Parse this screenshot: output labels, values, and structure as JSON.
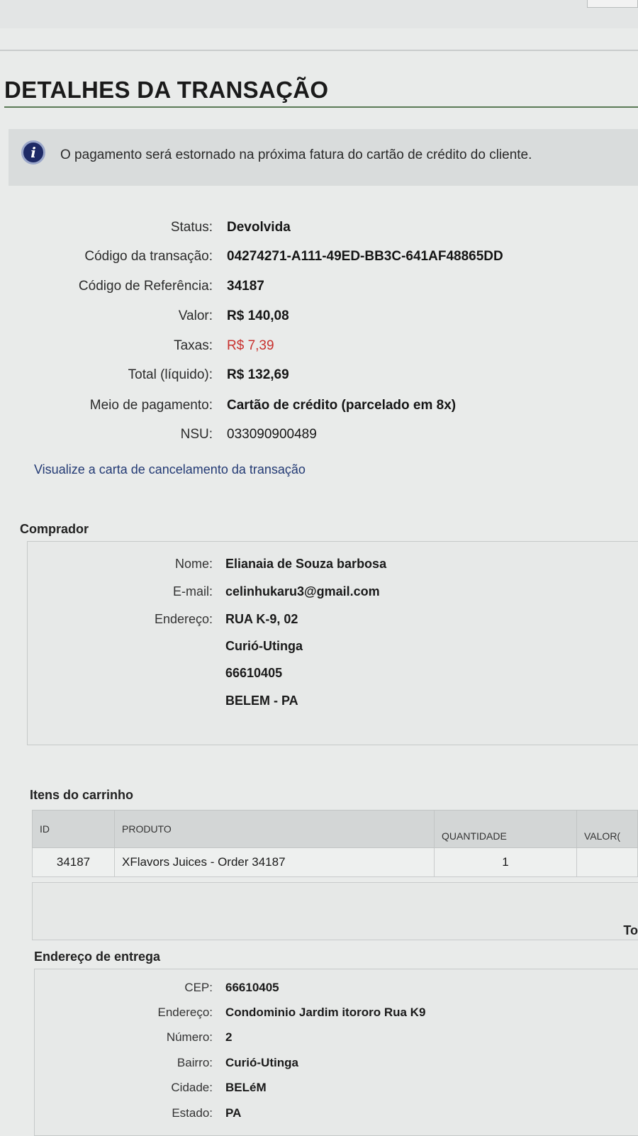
{
  "page": {
    "title": "DETALHES DA TRANSAÇÃO"
  },
  "notice": {
    "icon": "info-icon",
    "icon_glyph": "i",
    "text": "O pagamento será estornado na próxima fatura do cartão de crédito do cliente."
  },
  "transaction": {
    "status_label": "Status:",
    "status_value": "Devolvida",
    "code_label": "Código da transação:",
    "code_value": "04274271-A111-49ED-BB3C-641AF48865DD",
    "ref_label": "Código de Referência:",
    "ref_value": "34187",
    "valor_label": "Valor:",
    "valor_value": "R$ 140,08",
    "taxas_label": "Taxas:",
    "taxas_value": "R$ 7,39",
    "total_label": "Total (líquido):",
    "total_value": "R$ 132,69",
    "meio_label": "Meio de pagamento:",
    "meio_value": "Cartão de crédito (parcelado em 8x)",
    "nsu_label": "NSU:",
    "nsu_value": "033090900489",
    "cancel_link": "Visualize a carta de cancelamento da transação",
    "fee_color": "#c8312e"
  },
  "buyer": {
    "section_title": "Comprador",
    "name_label": "Nome:",
    "name_value": "Elianaia de Souza barbosa",
    "email_label": "E-mail:",
    "email_value": "celinhukaru3@gmail.com",
    "address_label": "Endereço:",
    "address_lines": [
      "RUA K-9, 02",
      "Curió-Utinga",
      "66610405",
      "BELEM - PA"
    ]
  },
  "cart": {
    "section_title": "Itens do carrinho",
    "headers": [
      "ID",
      "PRODUTO",
      "QUANTIDADE",
      "VALOR("
    ],
    "rows": [
      {
        "id": "34187",
        "product": "XFlavors Juices - Order 34187",
        "quantity": "1",
        "value": ""
      }
    ],
    "total_label": "To"
  },
  "shipping": {
    "section_title": "Endereço de entrega",
    "cep_label": "CEP:",
    "cep_value": "66610405",
    "endereco_label": "Endereço:",
    "endereco_value": "Condominio Jardim itororo Rua K9",
    "numero_label": "Número:",
    "numero_value": "2",
    "bairro_label": "Bairro:",
    "bairro_value": "Curió-Utinga",
    "cidade_label": "Cidade:",
    "cidade_value": "BELéM",
    "estado_label": "Estado:",
    "estado_value": "PA"
  }
}
